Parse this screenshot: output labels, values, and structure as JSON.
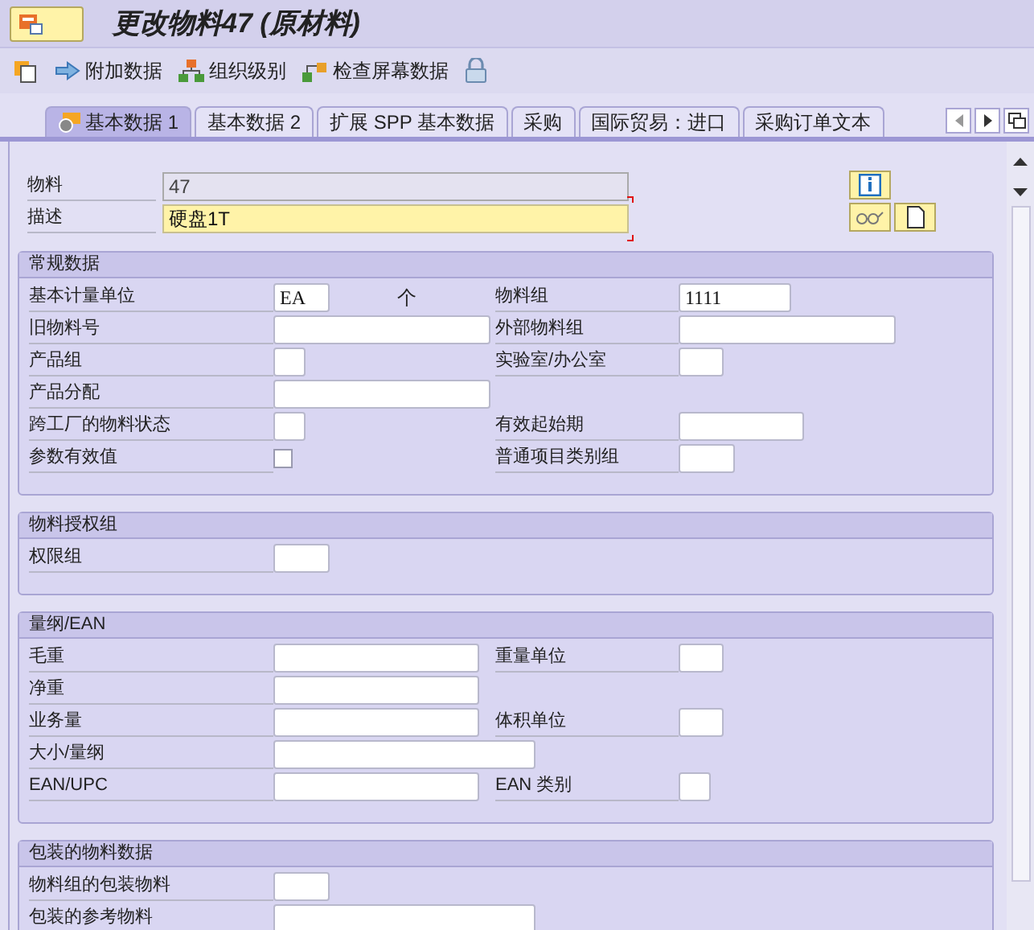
{
  "title": "更改物料47 (原材料)",
  "toolbar": [
    "附加数据",
    "组织级别",
    "检查屏幕数据"
  ],
  "tabs": [
    {
      "label": "基本数据 1",
      "selected": true
    },
    {
      "label": "基本数据 2",
      "selected": false
    },
    {
      "label": "扩展 SPP 基本数据",
      "selected": false
    },
    {
      "label": "采购",
      "selected": false
    },
    {
      "label": "国际贸易：进口",
      "selected": false
    },
    {
      "label": "采购订单文本",
      "selected": false
    }
  ],
  "header": [
    {
      "label": "物料",
      "value": "47",
      "kind": "readonly"
    },
    {
      "label": "描述",
      "value": "硬盘1T",
      "kind": "focused"
    }
  ],
  "sections": [
    {
      "title": "常规数据",
      "rows": [
        {
          "left": {
            "label": "基本计量单位",
            "value": "EA",
            "unit": "个"
          },
          "right": {
            "label": "物料组",
            "value": "1111"
          }
        },
        {
          "left": {
            "label": "旧物料号"
          },
          "right": {
            "label": "外部物料组"
          }
        },
        {
          "left": {
            "label": "产品组"
          },
          "right": {
            "label": "实验室/办公室"
          }
        },
        {
          "left": {
            "label": "产品分配"
          }
        },
        {
          "left": {
            "label": "跨工厂的物料状态"
          },
          "right": {
            "label": "有效起始期"
          }
        },
        {
          "left": {
            "label": "参数有效值",
            "kind": "checkbox",
            "checked": false
          },
          "right": {
            "label": "普通项目类别组"
          }
        }
      ]
    },
    {
      "title": "物料授权组",
      "rows": [
        {
          "left": {
            "label": "权限组"
          }
        }
      ]
    },
    {
      "title": "量纲/EAN",
      "rows": [
        {
          "left": {
            "label": "毛重"
          },
          "right": {
            "label": "重量单位"
          }
        },
        {
          "left": {
            "label": "净重"
          }
        },
        {
          "left": {
            "label": "业务量"
          },
          "right": {
            "label": "体积单位"
          }
        },
        {
          "left": {
            "label": "大小/量纲"
          }
        },
        {
          "left": {
            "label": "EAN/UPC"
          },
          "right": {
            "label": "EAN 类别"
          }
        }
      ]
    },
    {
      "title": "包装的物料数据",
      "rows": [
        {
          "left": {
            "label": "物料组的包装物料"
          }
        },
        {
          "left": {
            "label": "包装的参考物料"
          }
        }
      ]
    }
  ]
}
